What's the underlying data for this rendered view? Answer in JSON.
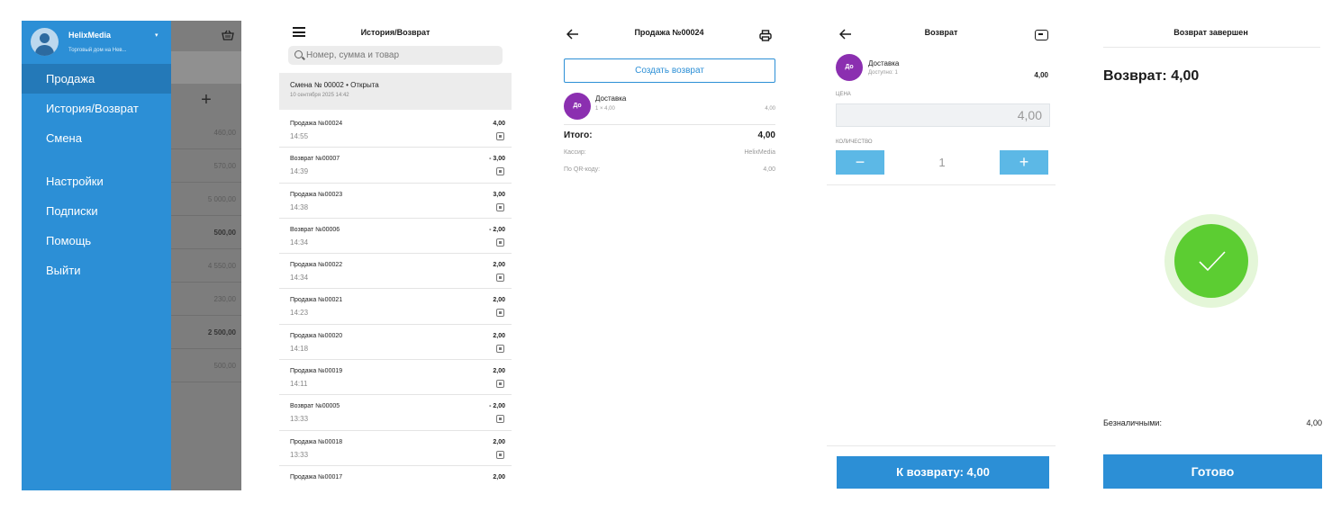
{
  "drawer": {
    "account_name": "HelixMedia",
    "account_subtitle": "Торговый дом на Нев...",
    "menu": [
      "Продажа",
      "История/Возврат",
      "Смена",
      "Настройки",
      "Подписки",
      "Помощь",
      "Выйти"
    ],
    "active_item": "Продажа",
    "background_amounts": [
      "460,00",
      "570,00",
      "5 000,00",
      "500,00",
      "4 550,00",
      "230,00",
      "2 500,00",
      "500,00"
    ],
    "plus_symbol": "+",
    "icons": [
      "caret-down-icon",
      "basket-icon",
      "avatar"
    ],
    "colors": {
      "drawer": "#2c8fd6",
      "active": "#2479b8"
    }
  },
  "history": {
    "title": "История/Возврат",
    "search_placeholder": "Номер, сумма и товар",
    "shift_title": "Смена № 00002 • Открыта",
    "shift_date": "10 сентября 2025 14:42",
    "rows": [
      {
        "name": "Продажа №00024",
        "time": "14:55",
        "amount": "4,00"
      },
      {
        "name": "Возврат №00007",
        "time": "14:39",
        "amount": "- 3,00"
      },
      {
        "name": "Продажа №00023",
        "time": "14:38",
        "amount": "3,00"
      },
      {
        "name": "Возврат №00006",
        "time": "14:34",
        "amount": "- 2,00"
      },
      {
        "name": "Продажа №00022",
        "time": "14:34",
        "amount": "2,00"
      },
      {
        "name": "Продажа №00021",
        "time": "14:23",
        "amount": "2,00"
      },
      {
        "name": "Продажа №00020",
        "time": "14:18",
        "amount": "2,00"
      },
      {
        "name": "Продажа №00019",
        "time": "14:11",
        "amount": "2,00"
      },
      {
        "name": "Возврат №00005",
        "time": "13:33",
        "amount": "- 2,00"
      },
      {
        "name": "Продажа №00018",
        "time": "13:33",
        "amount": "2,00"
      },
      {
        "name": "Продажа №00017",
        "time": "",
        "amount": "2,00"
      }
    ]
  },
  "sale": {
    "title": "Продажа №00024",
    "create_return": "Создать возврат",
    "item_badge": "До",
    "item_name": "Доставка",
    "item_qty_price": "1 × 4,00",
    "item_price": "4,00",
    "total_label": "Итого:",
    "total_value": "4,00",
    "cashier_label": "Кассир:",
    "cashier_value": "HelixMedia",
    "qr_label": "По QR-коду:",
    "qr_value": "4,00"
  },
  "return": {
    "title": "Возврат",
    "item_badge": "До",
    "item_name": "Доставка",
    "item_available": "Доступно: 1",
    "item_price": "4,00",
    "price_label": "ЦЕНА",
    "price_value": "4,00",
    "qty_label": "КОЛИЧЕСТВО",
    "qty_minus": "−",
    "qty_value": "1",
    "qty_plus": "+",
    "submit": "К возврату: 4,00"
  },
  "done": {
    "title": "Возврат завершен",
    "heading": "Возврат: 4,00",
    "pay_label": "Безналичными:",
    "pay_value": "4,00",
    "button": "Готово",
    "colors": {
      "check": "#5ccd32",
      "halo": "#e4f6d8",
      "primary": "#2c8fd6"
    }
  }
}
